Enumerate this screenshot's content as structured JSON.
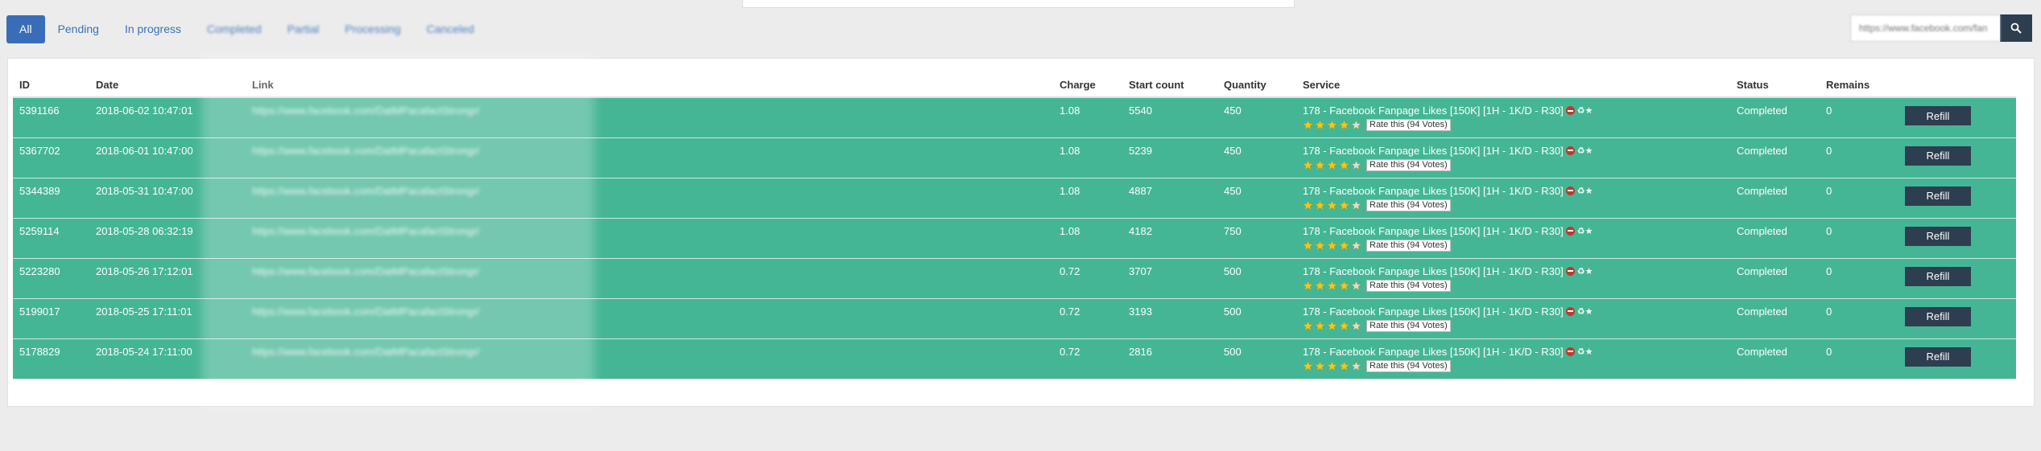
{
  "tabs": [
    {
      "label": "All",
      "active": true
    },
    {
      "label": "Pending"
    },
    {
      "label": "In progress"
    },
    {
      "label": "Completed"
    },
    {
      "label": "Partial"
    },
    {
      "label": "Processing"
    },
    {
      "label": "Canceled"
    }
  ],
  "search": {
    "placeholder": "https://www.facebook.com/fan"
  },
  "table": {
    "headers": [
      "ID",
      "Date",
      "Link",
      "Charge",
      "Start count",
      "Quantity",
      "Service",
      "Status",
      "Remains",
      ""
    ],
    "rows": [
      {
        "id": "5391166",
        "date": "2018-06-02 10:47:01",
        "link": "https://www.facebook.com/DatMPacafactStrongr/",
        "charge": "1.08",
        "start": "5540",
        "qty": "450",
        "service": "178 - Facebook Fanpage Likes [150K] [1H - 1K/D - R30]",
        "rate": "Rate this (94 Votes)",
        "status": "Completed",
        "remains": "0",
        "btn": "Refill"
      },
      {
        "id": "5367702",
        "date": "2018-06-01 10:47:00",
        "link": "https://www.facebook.com/DatMPacafactStrongr/",
        "charge": "1.08",
        "start": "5239",
        "qty": "450",
        "service": "178 - Facebook Fanpage Likes [150K] [1H - 1K/D - R30]",
        "rate": "Rate this (94 Votes)",
        "status": "Completed",
        "remains": "0",
        "btn": "Refill"
      },
      {
        "id": "5344389",
        "date": "2018-05-31 10:47:00",
        "link": "https://www.facebook.com/DatMPacafactStrongr/",
        "charge": "1.08",
        "start": "4887",
        "qty": "450",
        "service": "178 - Facebook Fanpage Likes [150K] [1H - 1K/D - R30]",
        "rate": "Rate this (94 Votes)",
        "status": "Completed",
        "remains": "0",
        "btn": "Refill"
      },
      {
        "id": "5259114",
        "date": "2018-05-28 06:32:19",
        "link": "https://www.facebook.com/DatMPacafactStrongr/",
        "charge": "1.08",
        "start": "4182",
        "qty": "750",
        "service": "178 - Facebook Fanpage Likes [150K] [1H - 1K/D - R30]",
        "rate": "Rate this (94 Votes)",
        "status": "Completed",
        "remains": "0",
        "btn": "Refill"
      },
      {
        "id": "5223280",
        "date": "2018-05-26 17:12:01",
        "link": "https://www.facebook.com/DatMPacafactStrongr/",
        "charge": "0.72",
        "start": "3707",
        "qty": "500",
        "service": "178 - Facebook Fanpage Likes [150K] [1H - 1K/D - R30]",
        "rate": "Rate this (94 Votes)",
        "status": "Completed",
        "remains": "0",
        "btn": "Refill"
      },
      {
        "id": "5199017",
        "date": "2018-05-25 17:11:01",
        "link": "https://www.facebook.com/DatMPacafactStrongr/",
        "charge": "0.72",
        "start": "3193",
        "qty": "500",
        "service": "178 - Facebook Fanpage Likes [150K] [1H - 1K/D - R30]",
        "rate": "Rate this (94 Votes)",
        "status": "Completed",
        "remains": "0",
        "btn": "Refill"
      },
      {
        "id": "5178829",
        "date": "2018-05-24 17:11:00",
        "link": "https://www.facebook.com/DatMPacafactStrongr/",
        "charge": "0.72",
        "start": "2816",
        "qty": "500",
        "service": "178 - Facebook Fanpage Likes [150K] [1H - 1K/D - R30]",
        "rate": "Rate this (94 Votes)",
        "status": "Completed",
        "remains": "0",
        "btn": "Refill"
      }
    ]
  },
  "rating": {
    "filled": 4,
    "max": 5
  },
  "colors": {
    "row": "#45b695",
    "accent": "#3a6db7",
    "button": "#2c3e50",
    "star": "#f5c518"
  },
  "icons": [
    "no-entry-icon",
    "recycle-icon",
    "star-icon",
    "search-icon"
  ]
}
